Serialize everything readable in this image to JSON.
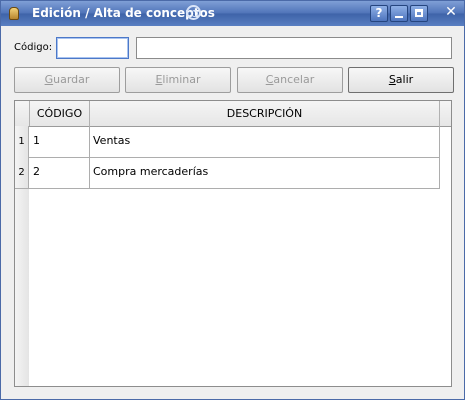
{
  "window": {
    "title": "Edición / Alta de conceptos",
    "controls": {
      "help": "?",
      "close": "✕"
    }
  },
  "form": {
    "code_label": "Código:",
    "code_value": "",
    "description_value": ""
  },
  "buttons": {
    "save": {
      "pre": "",
      "mnemonic": "G",
      "post": "uardar"
    },
    "delete": {
      "pre": "",
      "mnemonic": "E",
      "post": "liminar"
    },
    "cancel": {
      "pre": "",
      "mnemonic": "C",
      "post": "ancelar"
    },
    "exit": {
      "pre": "",
      "mnemonic": "S",
      "post": "alir"
    }
  },
  "table": {
    "columns": [
      "CÓDIGO",
      "DESCRIPCIÓN"
    ],
    "rows": [
      {
        "num": "1",
        "codigo": "1",
        "descripcion": "Ventas"
      },
      {
        "num": "2",
        "codigo": "2",
        "descripcion": "Compra mercaderías"
      }
    ]
  },
  "colors": {
    "titlebar": "#4f73b8",
    "focus_border": "#4c78c8",
    "disabled_text": "#9a9a9a"
  },
  "icons": [
    "app-bell-icon",
    "kde-swirl-icon",
    "help-icon",
    "minimize-icon",
    "maximize-icon",
    "close-icon"
  ]
}
